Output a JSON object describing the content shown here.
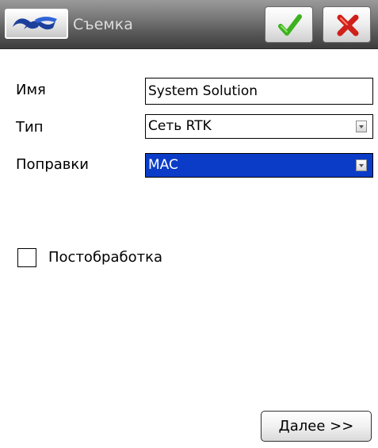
{
  "title_bar": {
    "title": "Съемка",
    "logo_icon": "trimble-logo-icon",
    "ok_icon": "checkmark-icon",
    "cancel_icon": "close-x-icon"
  },
  "form": {
    "name": {
      "label": "Имя",
      "value": "System Solution"
    },
    "type": {
      "label": "Тип",
      "value": "Сеть RTK"
    },
    "corrections": {
      "label": "Поправки",
      "value": "MAC"
    }
  },
  "postprocessing": {
    "label": "Постобработка",
    "checked": false
  },
  "footer": {
    "next_label": "Далее >>"
  },
  "colors": {
    "selection": "#0a3cc8",
    "ok_green": "#3db21e",
    "cancel_red": "#d0201a",
    "logo_blue": "#1d3f9c"
  }
}
